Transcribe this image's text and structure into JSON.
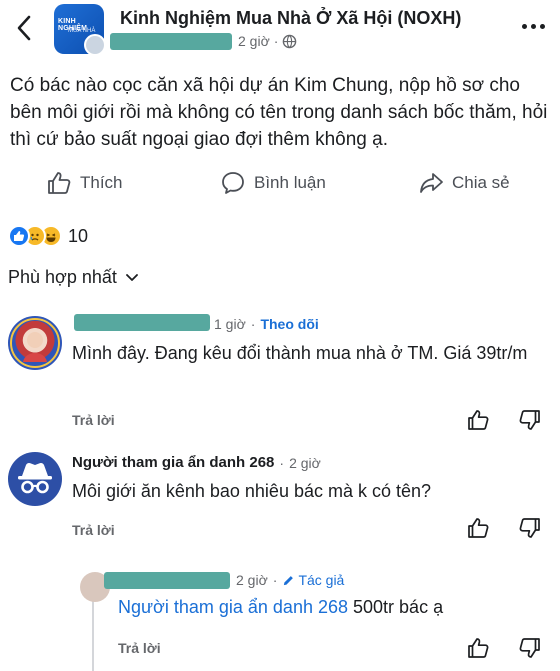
{
  "header": {
    "group_name": "Kinh Nghiệm Mua Nhà Ở Xã Hội (NOXH)",
    "avatar_text": "KINH NGHIỆM",
    "avatar_sub": "MUA NHÀ",
    "post_time": "2 giờ",
    "post_time_sep": "·"
  },
  "post": {
    "text": "Có bác nào cọc căn xã hội dự án Kim Chung, nộp hồ sơ cho bên môi giới rồi mà không có tên trong danh sách bốc thăm, hỏi thì cứ bảo suất ngoại giao đợi thêm không ạ."
  },
  "actions": {
    "like": "Thích",
    "comment": "Bình luận",
    "share": "Chia sẻ"
  },
  "reactions": {
    "count": "10",
    "types": [
      "like",
      "sad",
      "haha"
    ],
    "colors": {
      "like": "#1877f2",
      "sad": "#f7b928",
      "haha": "#f7b928"
    }
  },
  "sort": {
    "label": "Phù hợp nhất"
  },
  "comments": [
    {
      "time": "1 giờ",
      "sep": "·",
      "follow": "Theo dõi",
      "text": "Mình đây. Đang kêu đổi thành mua nhà ở TM. Giá 39tr/m",
      "reply": "Trả lời"
    },
    {
      "author": "Người tham gia ẩn danh 268",
      "sep": "·",
      "time": "2 giờ",
      "text": "Môi giới ăn kênh bao nhiêu bác mà k có tên?",
      "reply": "Trả lời"
    },
    {
      "time": "2 giờ",
      "sep": "·",
      "author_tag": "Tác giả",
      "mention": "Người tham gia ẩn danh 268",
      "text": " 500tr bác ạ",
      "reply": "Trả lời"
    }
  ],
  "colors": {
    "accent": "#1a6fd6",
    "redaction": "#57a89f",
    "secondary_text": "#65676b"
  }
}
